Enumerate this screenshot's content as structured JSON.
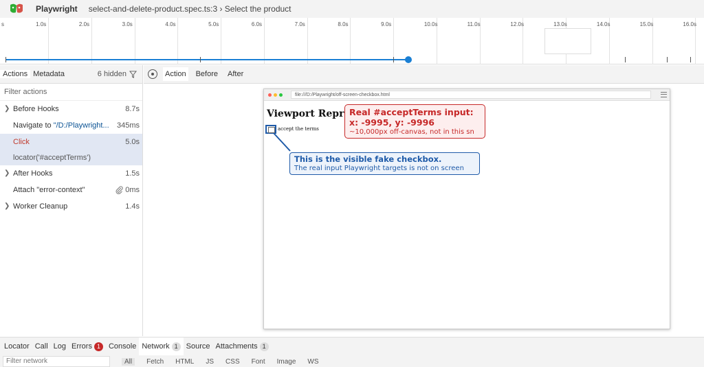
{
  "titlebar": {
    "app_name": "Playwright",
    "breadcrumb": "select-and-delete-product.spec.ts:3 › Select the product"
  },
  "timeline": {
    "start_label": "s",
    "ticks": [
      "1.0s",
      "2.0s",
      "3.0s",
      "4.0s",
      "5.0s",
      "6.0s",
      "7.0s",
      "8.0s",
      "9.0s",
      "10.0s",
      "11.0s",
      "12.0s",
      "13.0s",
      "14.0s",
      "15.0s",
      "16.0s"
    ],
    "accent_color": "#1a7fd4"
  },
  "left_panel": {
    "tabs": [
      "Actions",
      "Metadata"
    ],
    "hidden_label": "6 hidden",
    "filter_placeholder": "Filter actions",
    "actions": [
      {
        "title": "Before Hooks",
        "duration": "8.7s"
      },
      {
        "title": "Navigate to",
        "url": "\"/D:/Playwright...",
        "duration": "345ms"
      },
      {
        "title": "Click",
        "duration": "5.0s",
        "subtitle": "locator('#acceptTerms')"
      },
      {
        "title": "After Hooks",
        "duration": "1.5s"
      },
      {
        "title": "Attach \"error-context\"",
        "duration": "0ms"
      },
      {
        "title": "Worker Cleanup",
        "duration": "1.4s"
      }
    ]
  },
  "right_panel": {
    "tabs": [
      "Action",
      "Before",
      "After"
    ],
    "snapshot": {
      "address": "file:///D:/Playwright/off-screen-checkbox.html",
      "heading": "Viewport Repro",
      "checkbox_label": "accept the terms",
      "red_callout": {
        "line1": "Real #acceptTerms input:",
        "line2": "x: -9995, y: -9996",
        "line3": "~10,000px off-canvas, not in this sn"
      },
      "blue_callout": {
        "line1": "This is the visible fake checkbox.",
        "line2": "The real input Playwright targets is not on screen"
      }
    }
  },
  "bottom_panel": {
    "tabs": [
      {
        "label": "Locator"
      },
      {
        "label": "Call"
      },
      {
        "label": "Log"
      },
      {
        "label": "Errors",
        "badge": "1"
      },
      {
        "label": "Console"
      },
      {
        "label": "Network",
        "badge": "1"
      },
      {
        "label": "Source"
      },
      {
        "label": "Attachments",
        "badge": "1"
      }
    ],
    "network_filter_placeholder": "Filter network",
    "network_types": [
      "All",
      "Fetch",
      "HTML",
      "JS",
      "CSS",
      "Font",
      "Image",
      "WS"
    ]
  }
}
